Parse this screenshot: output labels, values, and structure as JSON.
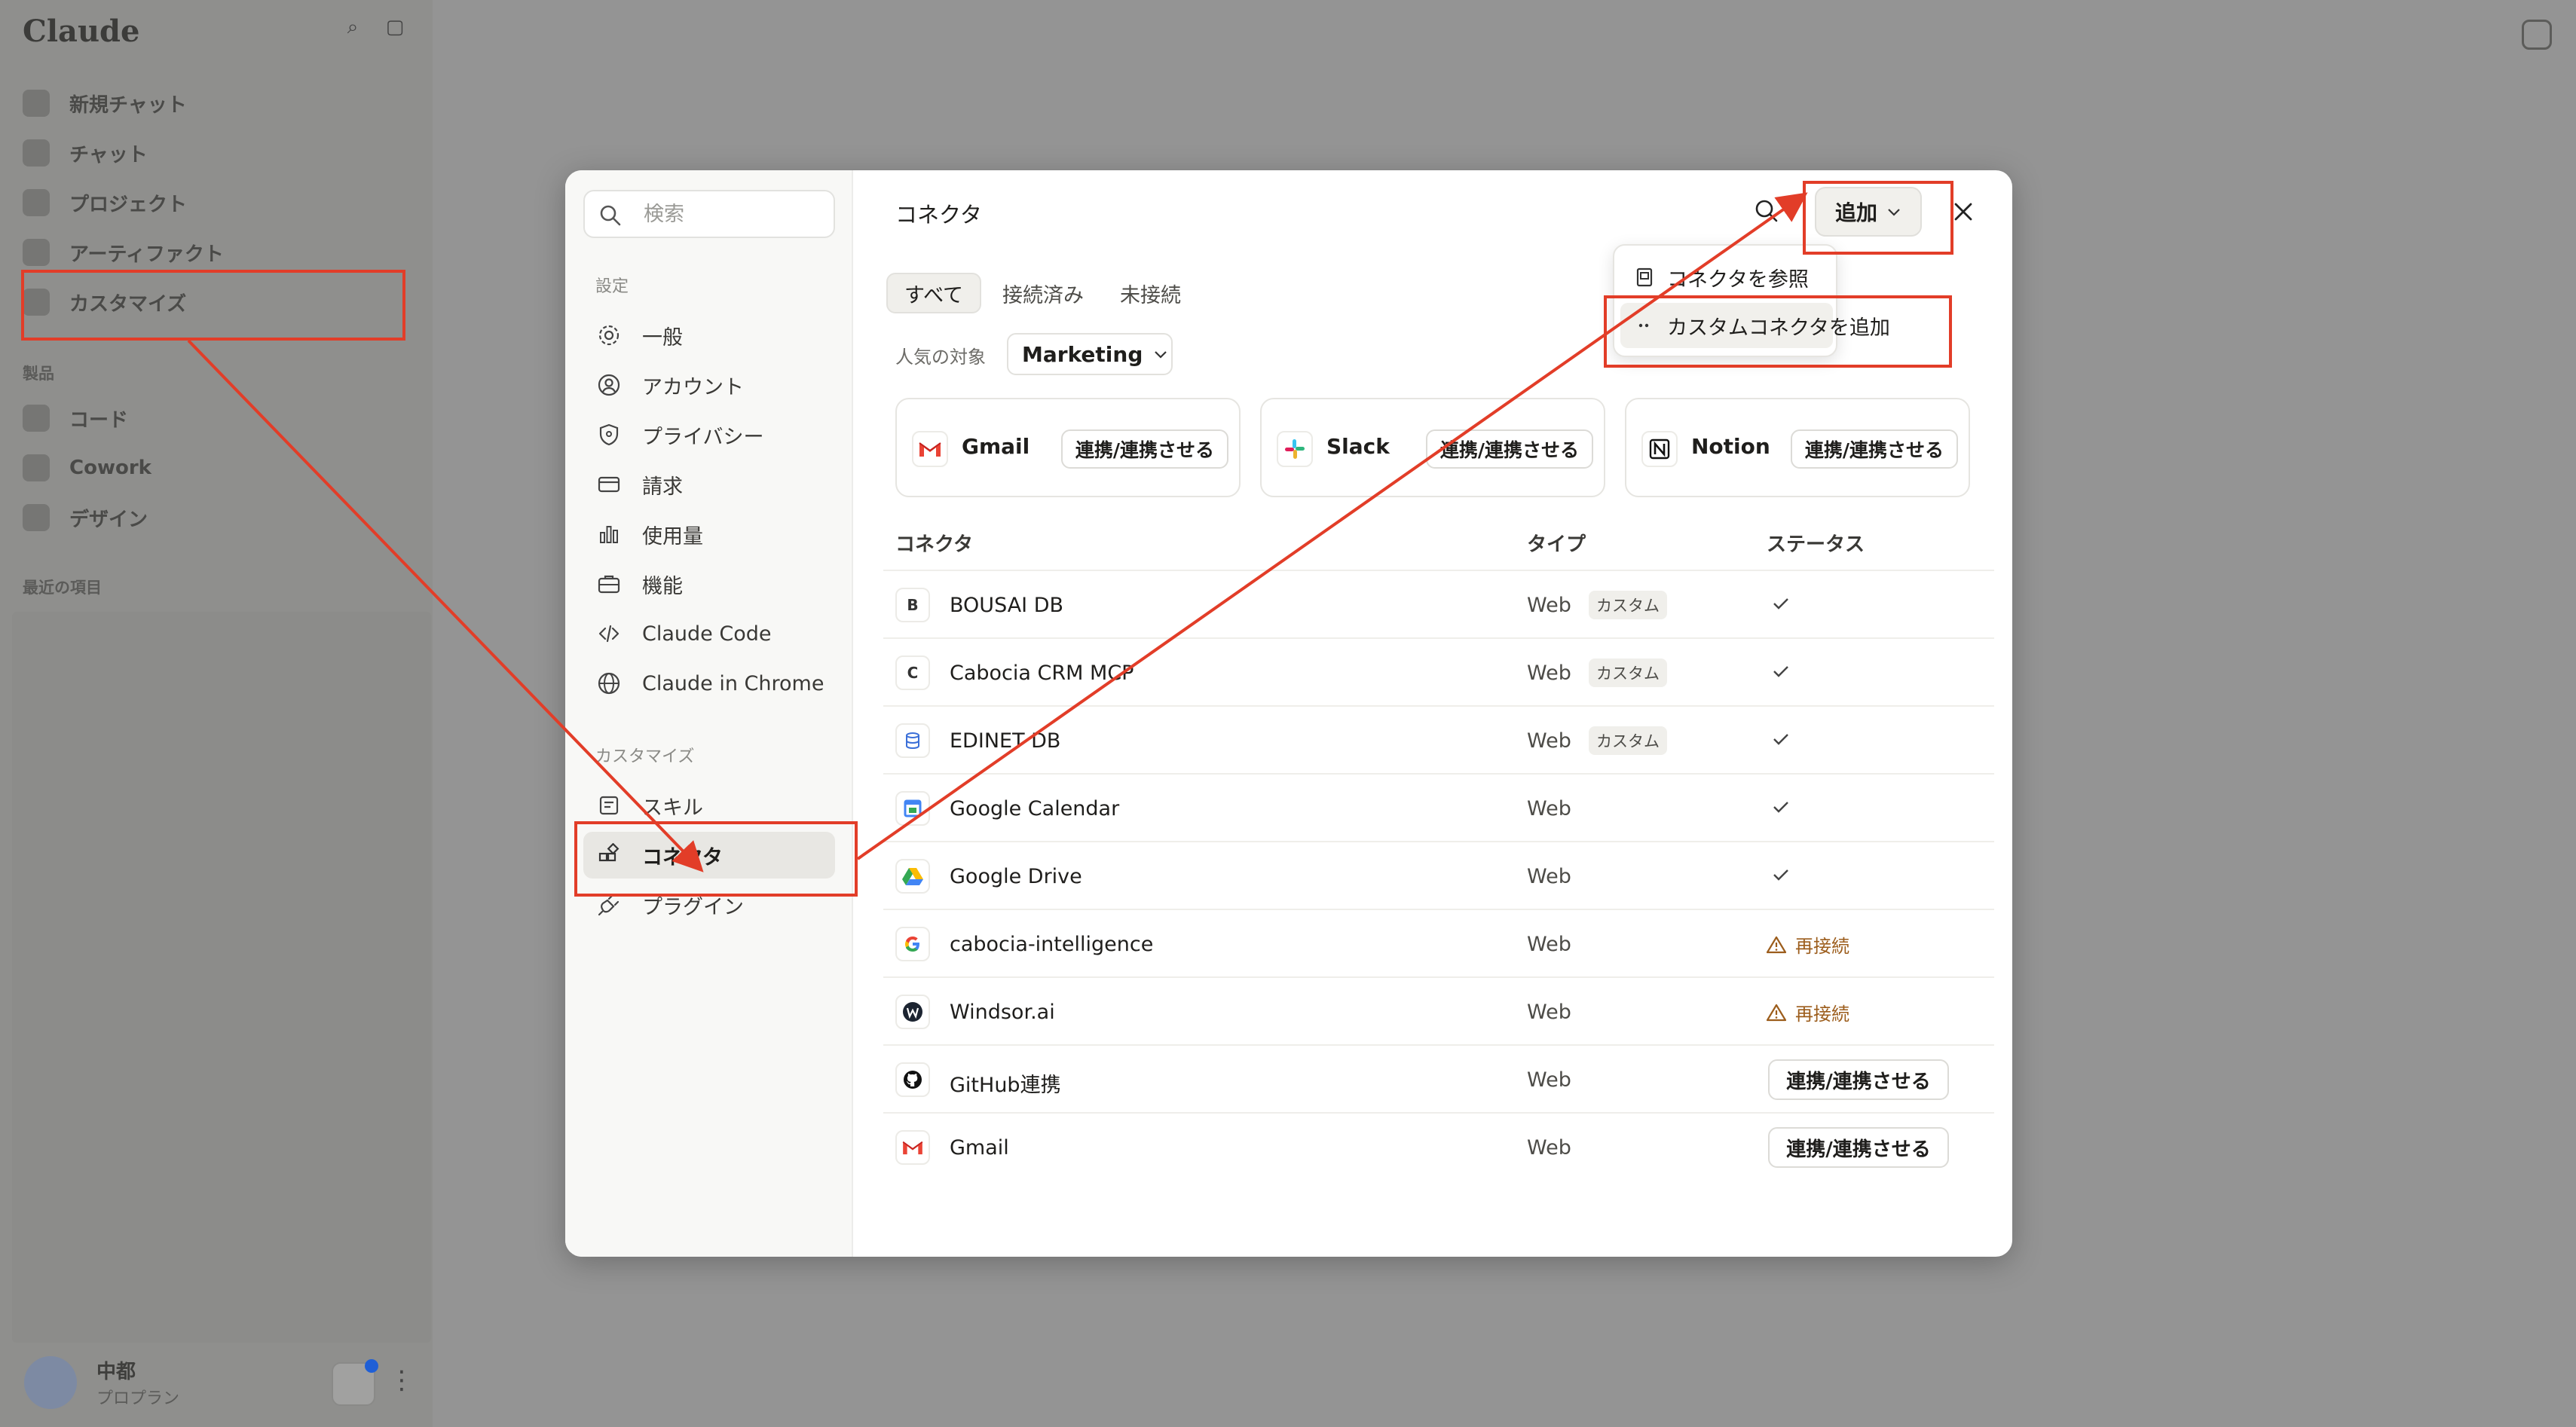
{
  "app": {
    "logo": "Claude",
    "nav": [
      {
        "label": "新規チャット"
      },
      {
        "label": "チャット"
      },
      {
        "label": "プロジェクト"
      },
      {
        "label": "アーティファクト"
      },
      {
        "label": "カスタマイズ"
      }
    ],
    "section_products": "製品",
    "products": [
      {
        "label": "コード"
      },
      {
        "label": "Cowork"
      },
      {
        "label": "デザイン"
      }
    ],
    "section_recent": "最近の項目",
    "user": {
      "name": "中都",
      "plan": "プロプラン"
    }
  },
  "settings": {
    "search_placeholder": "検索",
    "section_settings": "設定",
    "items": [
      {
        "label": "一般",
        "icon": "gear-icon"
      },
      {
        "label": "アカウント",
        "icon": "user-circle-icon"
      },
      {
        "label": "プライバシー",
        "icon": "shield-icon"
      },
      {
        "label": "請求",
        "icon": "card-icon"
      },
      {
        "label": "使用量",
        "icon": "bar-chart-icon"
      },
      {
        "label": "機能",
        "icon": "briefcase-icon"
      },
      {
        "label": "Claude Code",
        "icon": "code-icon"
      },
      {
        "label": "Claude in Chrome",
        "icon": "globe-icon"
      }
    ],
    "section_customize": "カスタマイズ",
    "customize_items": [
      {
        "label": "スキル",
        "icon": "skill-icon"
      },
      {
        "label": "コネクタ",
        "icon": "connector-icon",
        "active": true
      },
      {
        "label": "プラグイン",
        "icon": "plug-icon"
      }
    ]
  },
  "content": {
    "title": "コネクタ",
    "add_label": "追加",
    "tabs": [
      "すべて",
      "接続済み",
      "未接続"
    ],
    "popular_label": "人気の対象",
    "popular_value": "Marketing",
    "cards": [
      {
        "name": "Gmail",
        "button": "連携/連携させる"
      },
      {
        "name": "Slack",
        "button": "連携/連携させる"
      },
      {
        "name": "Notion",
        "button": "連携/連携させる"
      }
    ],
    "columns": {
      "name": "コネクタ",
      "type": "タイプ",
      "status": "ステータス"
    },
    "rows": [
      {
        "icon": "B",
        "name": "BOUSAI DB",
        "type": "Web",
        "badge": "カスタム",
        "status": "connected"
      },
      {
        "icon": "C",
        "name": "Cabocia CRM MCP",
        "type": "Web",
        "badge": "カスタム",
        "status": "connected"
      },
      {
        "icon": "edinet-icon",
        "name": "EDINET DB",
        "type": "Web",
        "badge": "カスタム",
        "status": "connected"
      },
      {
        "icon": "google-calendar-icon",
        "name": "Google Calendar",
        "type": "Web",
        "badge": "",
        "status": "connected"
      },
      {
        "icon": "google-drive-icon",
        "name": "Google Drive",
        "type": "Web",
        "badge": "",
        "status": "connected"
      },
      {
        "icon": "google-icon",
        "name": "cabocia-intelligence",
        "type": "Web",
        "badge": "",
        "status": "再接続"
      },
      {
        "icon": "windsor-icon",
        "name": "Windsor.ai",
        "type": "Web",
        "badge": "",
        "status": "再接続"
      },
      {
        "icon": "github-icon",
        "name": "GitHub連携",
        "type": "Web",
        "badge": "",
        "status": "連携/連携させる"
      },
      {
        "icon": "gmail-icon",
        "name": "Gmail",
        "type": "Web",
        "badge": "",
        "status": "連携/連携させる"
      }
    ],
    "add_menu": [
      {
        "label": "コネクタを参照",
        "icon": "book-icon"
      },
      {
        "label": "カスタムコネクタを追加",
        "icon": "dots-icon"
      }
    ]
  },
  "colors": {
    "annotation": "#e23d28",
    "accent_warn": "#9c5d1c"
  }
}
